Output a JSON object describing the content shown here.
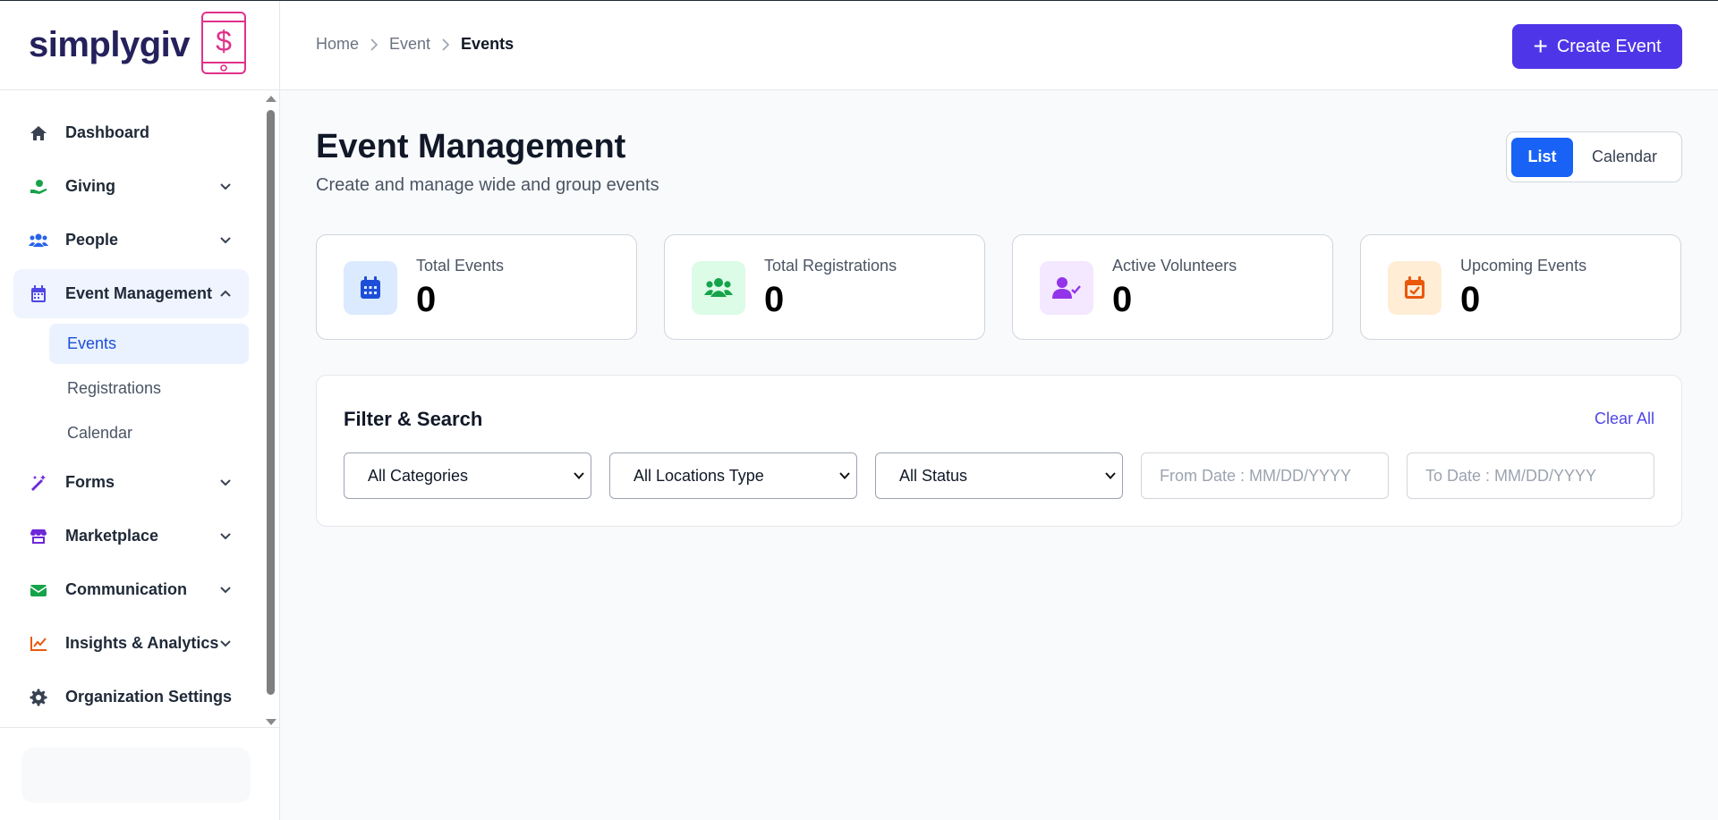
{
  "brand": {
    "name": "simplygiv",
    "color": "#25215c",
    "accent": "#e0318a"
  },
  "sidebar": {
    "items": [
      {
        "label": "Dashboard",
        "icon": "home-icon",
        "color": "#374151",
        "expandable": false
      },
      {
        "label": "Giving",
        "icon": "hand-heart-icon",
        "color": "#16a34a",
        "expandable": true
      },
      {
        "label": "People",
        "icon": "users-icon",
        "color": "#2563eb",
        "expandable": true
      },
      {
        "label": "Event Management",
        "icon": "calendar-icon",
        "color": "#4f46e5",
        "expandable": true,
        "expanded": true
      },
      {
        "label": "Forms",
        "icon": "magic-wand-icon",
        "color": "#6d28d9",
        "expandable": true
      },
      {
        "label": "Marketplace",
        "icon": "store-icon",
        "color": "#6d28d9",
        "expandable": true
      },
      {
        "label": "Communication",
        "icon": "envelope-icon",
        "color": "#16a34a",
        "expandable": true
      },
      {
        "label": "Insights & Analytics",
        "icon": "chart-line-icon",
        "color": "#ea580c",
        "expandable": true
      },
      {
        "label": "Organization Settings",
        "icon": "gear-icon",
        "color": "#374151",
        "expandable": false
      }
    ],
    "subitems": [
      {
        "label": "Events",
        "active": true
      },
      {
        "label": "Registrations",
        "active": false
      },
      {
        "label": "Calendar",
        "active": false
      }
    ]
  },
  "breadcrumb": {
    "home": "Home",
    "section": "Event",
    "current": "Events"
  },
  "header": {
    "create_label": "Create Event",
    "create_color": "#4f35e8"
  },
  "page": {
    "title": "Event Management",
    "subtitle": "Create and manage wide and group events"
  },
  "view_toggle": {
    "list": "List",
    "calendar": "Calendar",
    "selected": "List"
  },
  "stats": [
    {
      "label": "Total Events",
      "value": "0",
      "icon": "calendar-grid-icon",
      "bg": "#dbeafe",
      "fg": "#1d4ed8"
    },
    {
      "label": "Total Registrations",
      "value": "0",
      "icon": "users-group-icon",
      "bg": "#dcfce7",
      "fg": "#16a34a"
    },
    {
      "label": "Active Volunteers",
      "value": "0",
      "icon": "user-check-icon",
      "bg": "#f3e8ff",
      "fg": "#9333ea"
    },
    {
      "label": "Upcoming Events",
      "value": "0",
      "icon": "calendar-check-icon",
      "bg": "#ffedd5",
      "fg": "#ea580c"
    }
  ],
  "filters": {
    "title": "Filter & Search",
    "clear_label": "Clear All",
    "category": "All Categories",
    "location_type": "All Locations Type",
    "status": "All Status",
    "from_placeholder": "From Date : MM/DD/YYYY",
    "to_placeholder": "To Date : MM/DD/YYYY"
  }
}
